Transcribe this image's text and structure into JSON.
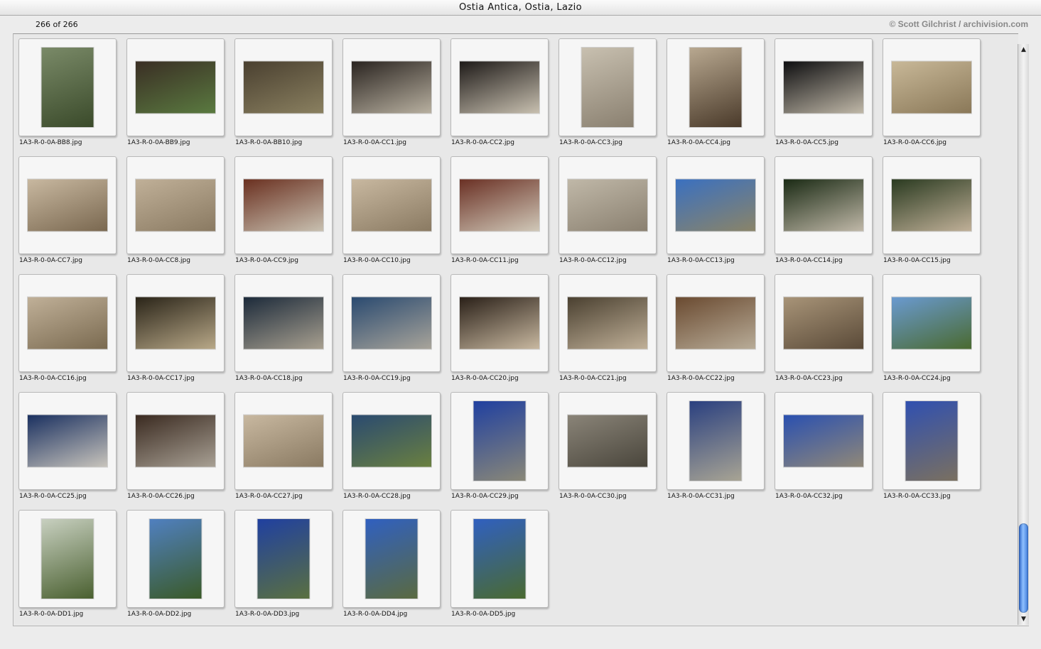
{
  "window": {
    "title": "Ostia Antica, Ostia, Lazio"
  },
  "info": {
    "count": "266 of 266",
    "credit": "© Scott Gilchrist / archivision.com"
  },
  "images": [
    {
      "file": "1A3-R-0-0A-BB8.jpg",
      "orient": "p",
      "c1": "#7a8a68",
      "c2": "#3a4a2a"
    },
    {
      "file": "1A3-R-0-0A-BB9.jpg",
      "orient": "l",
      "c1": "#3a2e24",
      "c2": "#5a7a40"
    },
    {
      "file": "1A3-R-0-0A-BB10.jpg",
      "orient": "l",
      "c1": "#4a4030",
      "c2": "#8a8060"
    },
    {
      "file": "1A3-R-0-0A-CC1.jpg",
      "orient": "l",
      "c1": "#2a2420",
      "c2": "#b8b0a0"
    },
    {
      "file": "1A3-R-0-0A-CC2.jpg",
      "orient": "l",
      "c1": "#1e1a18",
      "c2": "#c8c0b0"
    },
    {
      "file": "1A3-R-0-0A-CC3.jpg",
      "orient": "p",
      "c1": "#c8c0b0",
      "c2": "#8a8070"
    },
    {
      "file": "1A3-R-0-0A-CC4.jpg",
      "orient": "p",
      "c1": "#b8a890",
      "c2": "#4a3a2a"
    },
    {
      "file": "1A3-R-0-0A-CC5.jpg",
      "orient": "l",
      "c1": "#0e0e10",
      "c2": "#c0b8a8"
    },
    {
      "file": "1A3-R-0-0A-CC6.jpg",
      "orient": "l",
      "c1": "#c8b898",
      "c2": "#8a7858"
    },
    {
      "file": "1A3-R-0-0A-CC7.jpg",
      "orient": "l",
      "c1": "#c8b8a0",
      "c2": "#7a6850"
    },
    {
      "file": "1A3-R-0-0A-CC8.jpg",
      "orient": "l",
      "c1": "#c0b098",
      "c2": "#8a7a62"
    },
    {
      "file": "1A3-R-0-0A-CC9.jpg",
      "orient": "l",
      "c1": "#6a3020",
      "c2": "#c8c0b0"
    },
    {
      "file": "1A3-R-0-0A-CC10.jpg",
      "orient": "l",
      "c1": "#c8b8a0",
      "c2": "#8a7a62"
    },
    {
      "file": "1A3-R-0-0A-CC11.jpg",
      "orient": "l",
      "c1": "#6a3024",
      "c2": "#d0c8b8"
    },
    {
      "file": "1A3-R-0-0A-CC12.jpg",
      "orient": "l",
      "c1": "#c0b8a8",
      "c2": "#8a8070"
    },
    {
      "file": "1A3-R-0-0A-CC13.jpg",
      "orient": "l",
      "c1": "#3a70c0",
      "c2": "#8a8468"
    },
    {
      "file": "1A3-R-0-0A-CC14.jpg",
      "orient": "l",
      "c1": "#1a2a14",
      "c2": "#c0b8a8"
    },
    {
      "file": "1A3-R-0-0A-CC15.jpg",
      "orient": "l",
      "c1": "#2a3a20",
      "c2": "#c0b098"
    },
    {
      "file": "1A3-R-0-0A-CC16.jpg",
      "orient": "l",
      "c1": "#c0b098",
      "c2": "#7a6a50"
    },
    {
      "file": "1A3-R-0-0A-CC17.jpg",
      "orient": "l",
      "c1": "#2a2418",
      "c2": "#b8a888"
    },
    {
      "file": "1A3-R-0-0A-CC18.jpg",
      "orient": "l",
      "c1": "#1c2a3a",
      "c2": "#a8a090"
    },
    {
      "file": "1A3-R-0-0A-CC19.jpg",
      "orient": "l",
      "c1": "#2a4a70",
      "c2": "#a8a49a"
    },
    {
      "file": "1A3-R-0-0A-CC20.jpg",
      "orient": "l",
      "c1": "#2a2018",
      "c2": "#c8b8a0"
    },
    {
      "file": "1A3-R-0-0A-CC21.jpg",
      "orient": "l",
      "c1": "#4a4030",
      "c2": "#c0b098"
    },
    {
      "file": "1A3-R-0-0A-CC22.jpg",
      "orient": "l",
      "c1": "#6a4a30",
      "c2": "#b8ac98"
    },
    {
      "file": "1A3-R-0-0A-CC23.jpg",
      "orient": "l",
      "c1": "#a89478",
      "c2": "#5a4a38"
    },
    {
      "file": "1A3-R-0-0A-CC24.jpg",
      "orient": "l",
      "c1": "#6a9ad0",
      "c2": "#4a6a30"
    },
    {
      "file": "1A3-R-0-0A-CC25.jpg",
      "orient": "l",
      "c1": "#1a3060",
      "c2": "#c8c4bc"
    },
    {
      "file": "1A3-R-0-0A-CC26.jpg",
      "orient": "l",
      "c1": "#3a2a20",
      "c2": "#a8a094"
    },
    {
      "file": "1A3-R-0-0A-CC27.jpg",
      "orient": "l",
      "c1": "#c8b8a0",
      "c2": "#8a7a62"
    },
    {
      "file": "1A3-R-0-0A-CC28.jpg",
      "orient": "l",
      "c1": "#2a4a70",
      "c2": "#6a8040"
    },
    {
      "file": "1A3-R-0-0A-CC29.jpg",
      "orient": "p",
      "c1": "#2040a0",
      "c2": "#8a8878"
    },
    {
      "file": "1A3-R-0-0A-CC30.jpg",
      "orient": "l",
      "c1": "#8a8478",
      "c2": "#4a463c"
    },
    {
      "file": "1A3-R-0-0A-CC31.jpg",
      "orient": "p",
      "c1": "#2a4080",
      "c2": "#a8a494"
    },
    {
      "file": "1A3-R-0-0A-CC32.jpg",
      "orient": "l",
      "c1": "#2a50b0",
      "c2": "#908878"
    },
    {
      "file": "1A3-R-0-0A-CC33.jpg",
      "orient": "p",
      "c1": "#3050b0",
      "c2": "#7a7060"
    },
    {
      "file": "1A3-R-0-0A-DD1.jpg",
      "orient": "p",
      "c1": "#c8d0c0",
      "c2": "#4a6030"
    },
    {
      "file": "1A3-R-0-0A-DD2.jpg",
      "orient": "p",
      "c1": "#5080c0",
      "c2": "#3a5a28"
    },
    {
      "file": "1A3-R-0-0A-DD3.jpg",
      "orient": "p",
      "c1": "#2040a0",
      "c2": "#5a7040"
    },
    {
      "file": "1A3-R-0-0A-DD4.jpg",
      "orient": "p",
      "c1": "#3060c0",
      "c2": "#5a6a40"
    },
    {
      "file": "1A3-R-0-0A-DD5.jpg",
      "orient": "p",
      "c1": "#3060c0",
      "c2": "#4a6a30"
    }
  ]
}
